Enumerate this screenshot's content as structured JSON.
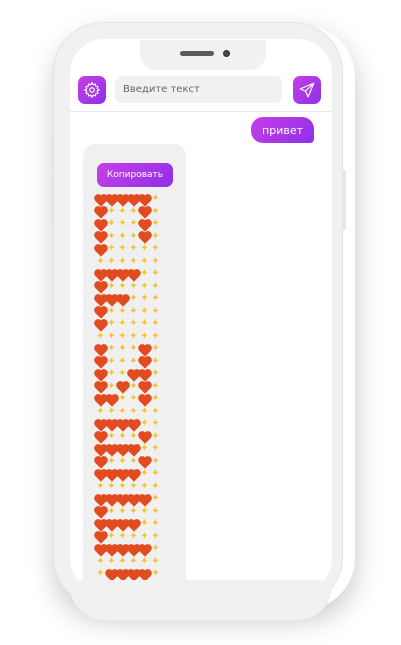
{
  "toolbar": {
    "input_placeholder": "Введите текст",
    "settings_icon": "gear-icon",
    "send_icon": "paper-plane-icon"
  },
  "colors": {
    "accent_start": "#c640e6",
    "accent_end": "#8f2fe8",
    "heart": "#e24a1f",
    "sparkle": "#f5c330"
  },
  "chat": {
    "user_message": "привет",
    "copy_label": "Копировать",
    "emoji_grid": [
      "HHHHHS",
      "HSSSHS",
      "HSSSHS",
      "HSSSHS",
      "HSSSSS",
      "SSSSSS",
      "HHHHSS",
      "HSSSSS",
      "HHHSSS",
      "HSSSSS",
      "HSSSSS",
      "SSSSSS",
      "HSSSHS",
      "HSSSHS",
      "HSSHHS",
      "HSHSHS",
      "HHSSHS",
      "SSSSSS",
      "HHHHSS",
      "HSSSHS",
      "HHHHSS",
      "HSSSHS",
      "HHHHSS",
      "SSSSSS",
      "HHHHHS",
      "HSSSSS",
      "HHHHSS",
      "HSSSSS",
      "HHHHHS",
      "SSSSSS",
      "SHHHHS"
    ]
  }
}
